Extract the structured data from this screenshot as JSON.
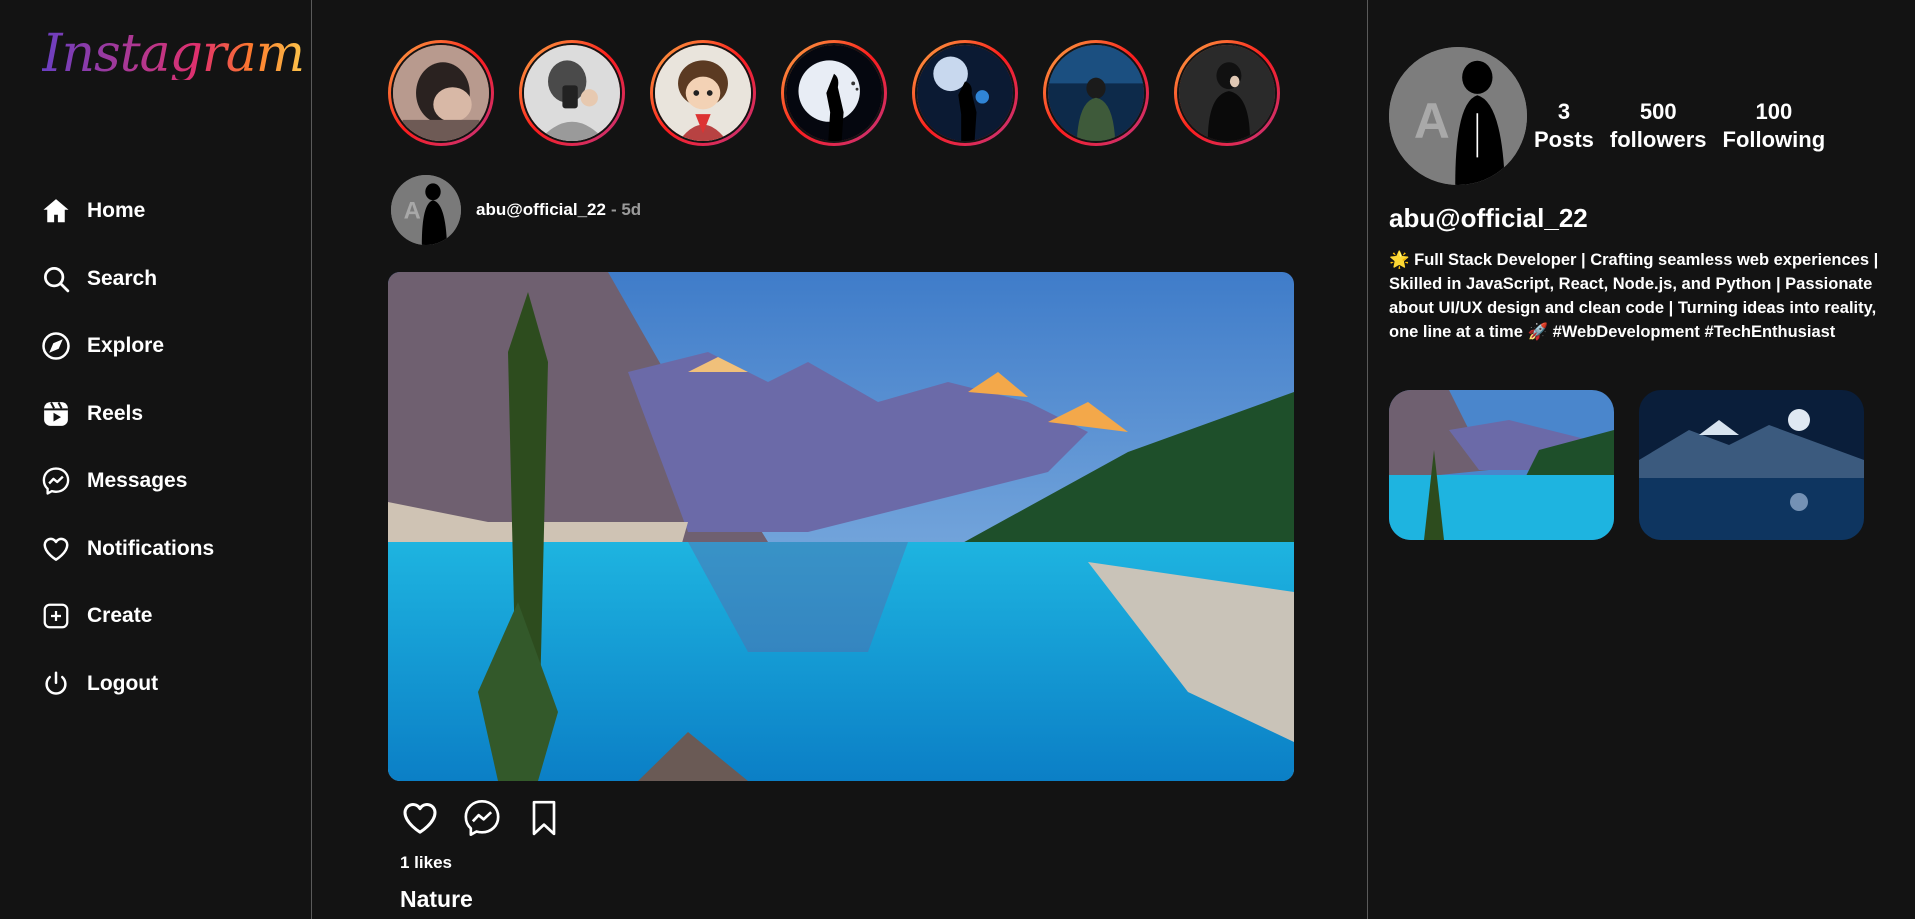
{
  "app": {
    "logo_text": "Instagram"
  },
  "nav": {
    "items": [
      {
        "label": "Home",
        "icon": "home-icon"
      },
      {
        "label": "Search",
        "icon": "search-icon"
      },
      {
        "label": "Explore",
        "icon": "compass-icon"
      },
      {
        "label": "Reels",
        "icon": "reels-icon"
      },
      {
        "label": "Messages",
        "icon": "messenger-icon"
      },
      {
        "label": "Notifications",
        "icon": "heart-icon"
      },
      {
        "label": "Create",
        "icon": "plus-square-icon"
      },
      {
        "label": "Logout",
        "icon": "power-icon"
      }
    ]
  },
  "stories": [
    {
      "id": "story-1"
    },
    {
      "id": "story-2"
    },
    {
      "id": "story-3"
    },
    {
      "id": "story-4"
    },
    {
      "id": "story-5"
    },
    {
      "id": "story-6"
    },
    {
      "id": "story-7"
    }
  ],
  "post": {
    "username": "abu@official_22",
    "time": "- 5d",
    "likes": "1 likes",
    "caption": "Nature"
  },
  "profile": {
    "username": "abu@official_22",
    "stats": [
      {
        "value": "3",
        "label": "Posts"
      },
      {
        "value": "500",
        "label": "followers"
      },
      {
        "value": "100",
        "label": "Following"
      }
    ],
    "bio": "🌟 Full Stack Developer | Crafting seamless web experiences | Skilled in JavaScript, React, Node.js, and Python | Passionate about UI/UX design and clean code | Turning ideas into reality, one line at a time 🚀 #WebDevelopment #TechEnthusiast"
  },
  "colors": {
    "background": "#131313",
    "divider": "#5a5a5a",
    "story_ring_start": "#fcaf45",
    "story_ring_end": "#c13584",
    "muted_text": "#9a9a9a"
  }
}
